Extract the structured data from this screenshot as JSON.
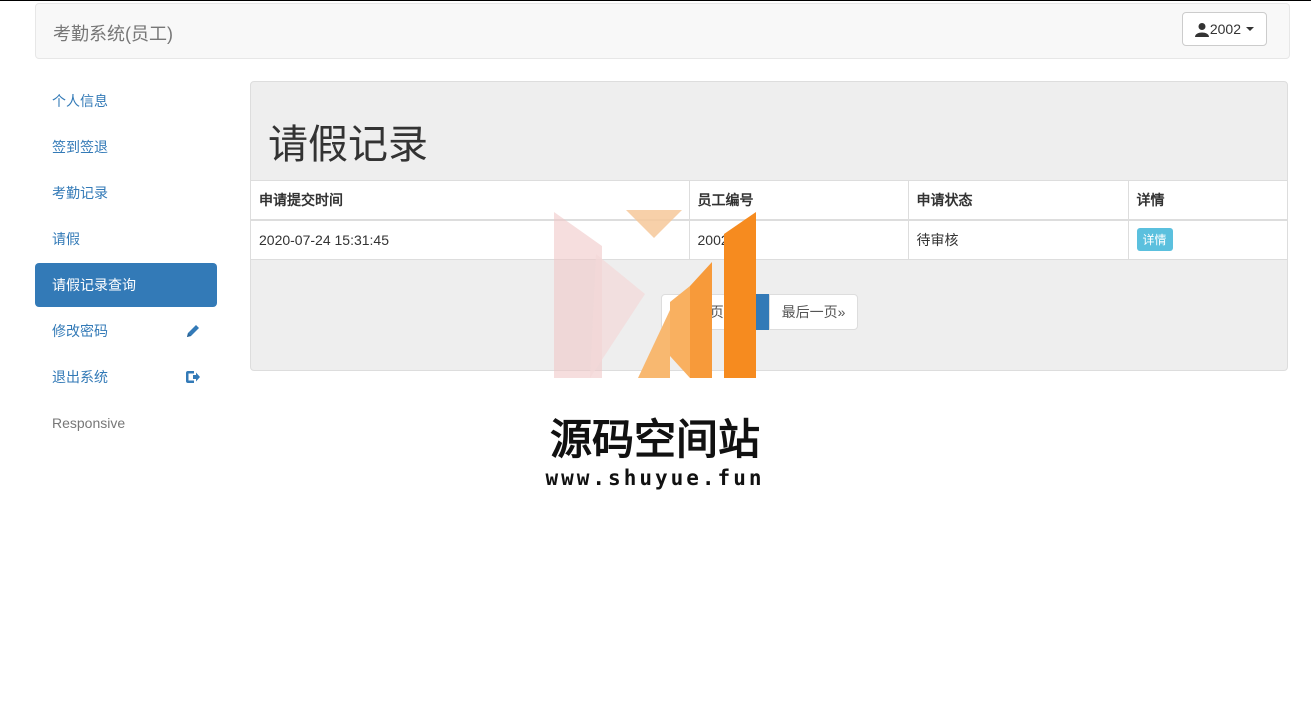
{
  "header": {
    "brand": "考勤系统(员工)",
    "user_label": "2002"
  },
  "sidebar": {
    "items": [
      {
        "label": "个人信息"
      },
      {
        "label": "签到签退"
      },
      {
        "label": "考勤记录"
      },
      {
        "label": "请假"
      },
      {
        "label": "请假记录查询"
      },
      {
        "label": "修改密码"
      },
      {
        "label": "退出系统"
      },
      {
        "label": "Responsive"
      }
    ]
  },
  "main": {
    "title": "请假记录",
    "table": {
      "columns": [
        "申请提交时间",
        "员工编号",
        "申请状态",
        "详情"
      ],
      "rows": [
        {
          "time": "2020-07-24 15:31:45",
          "emp_id": "2002",
          "status": "待审核",
          "detail": "详情"
        }
      ]
    },
    "pagination": {
      "first": "«第一页",
      "current": "1",
      "last": "最后一页»"
    }
  },
  "watermark": {
    "title": "源码空间站",
    "url": "www.shuyue.fun"
  },
  "colors": {
    "accent": "#337ab7",
    "info": "#5bc0de",
    "logo_orange": "#f68b1f"
  }
}
